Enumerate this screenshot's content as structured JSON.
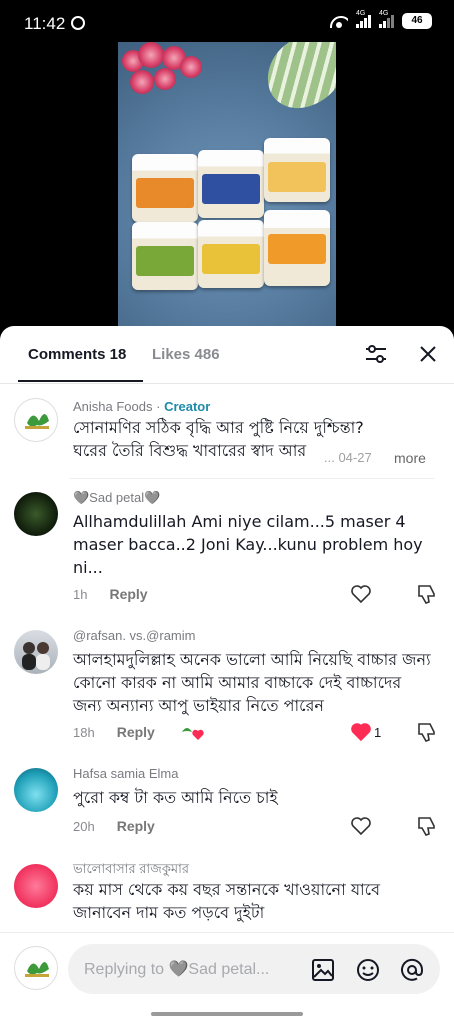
{
  "status_bar": {
    "time": "11:42",
    "signal1_label": "4G",
    "signal2_label": "4G",
    "battery": "46"
  },
  "tabs": {
    "comments_label": "Comments 18",
    "likes_label": "Likes 486"
  },
  "comments": [
    {
      "username": "Anisha Foods",
      "creator_label": "Creator",
      "text_line1": "সোনামণির সঠিক বৃদ্ধি আর পুষ্টি নিয়ে দুশ্চিন্তা?",
      "text_line2": "ঘরের তৈরি বিশুদ্ধ খাবারের স্বাদ আর",
      "date": "... 04-27",
      "more_label": "more"
    },
    {
      "username": "🩶Sad petal🩶",
      "text": "Allhamdulillah Ami niye cilam...5 maser 4 maser bacca..2 Joni Kay...kunu problem hoy ni...",
      "time": "1h",
      "reply_label": "Reply"
    },
    {
      "username": "@rafsan. vs.@ramim",
      "text": "আলহামদুলিল্লাহ অনেক ভালো আমি নিয়েছি বাচ্চার জন্য কোনো কারক না আমি আমার বাচ্চাকে দেই বাচ্চাদের জন্য অন্যান্য আপু ভাইয়ার নিতে পারেন",
      "time": "18h",
      "reply_label": "Reply",
      "like_count": "1"
    },
    {
      "username": "Hafsa samia Elma",
      "text": "পুরো কম্ব টা কত আমি নিতে চাই",
      "time": "20h",
      "reply_label": "Reply"
    },
    {
      "username": "ভালোবাসার রাজকুমার",
      "text": "কয় মাস থেকে কয় বছর সন্তানকে খাওয়ানো যাবে জানাবেন দাম কত পড়বে দুইটা"
    }
  ],
  "composer": {
    "placeholder": "Replying to 🩶Sad petal..."
  },
  "colors": {
    "accent_creator": "#1c8ba8",
    "liked_heart": "#fe2c55"
  },
  "icons": [
    "filter-icon",
    "close-icon",
    "heart-icon",
    "dislike-icon",
    "image-icon",
    "emoji-icon",
    "mention-icon"
  ]
}
